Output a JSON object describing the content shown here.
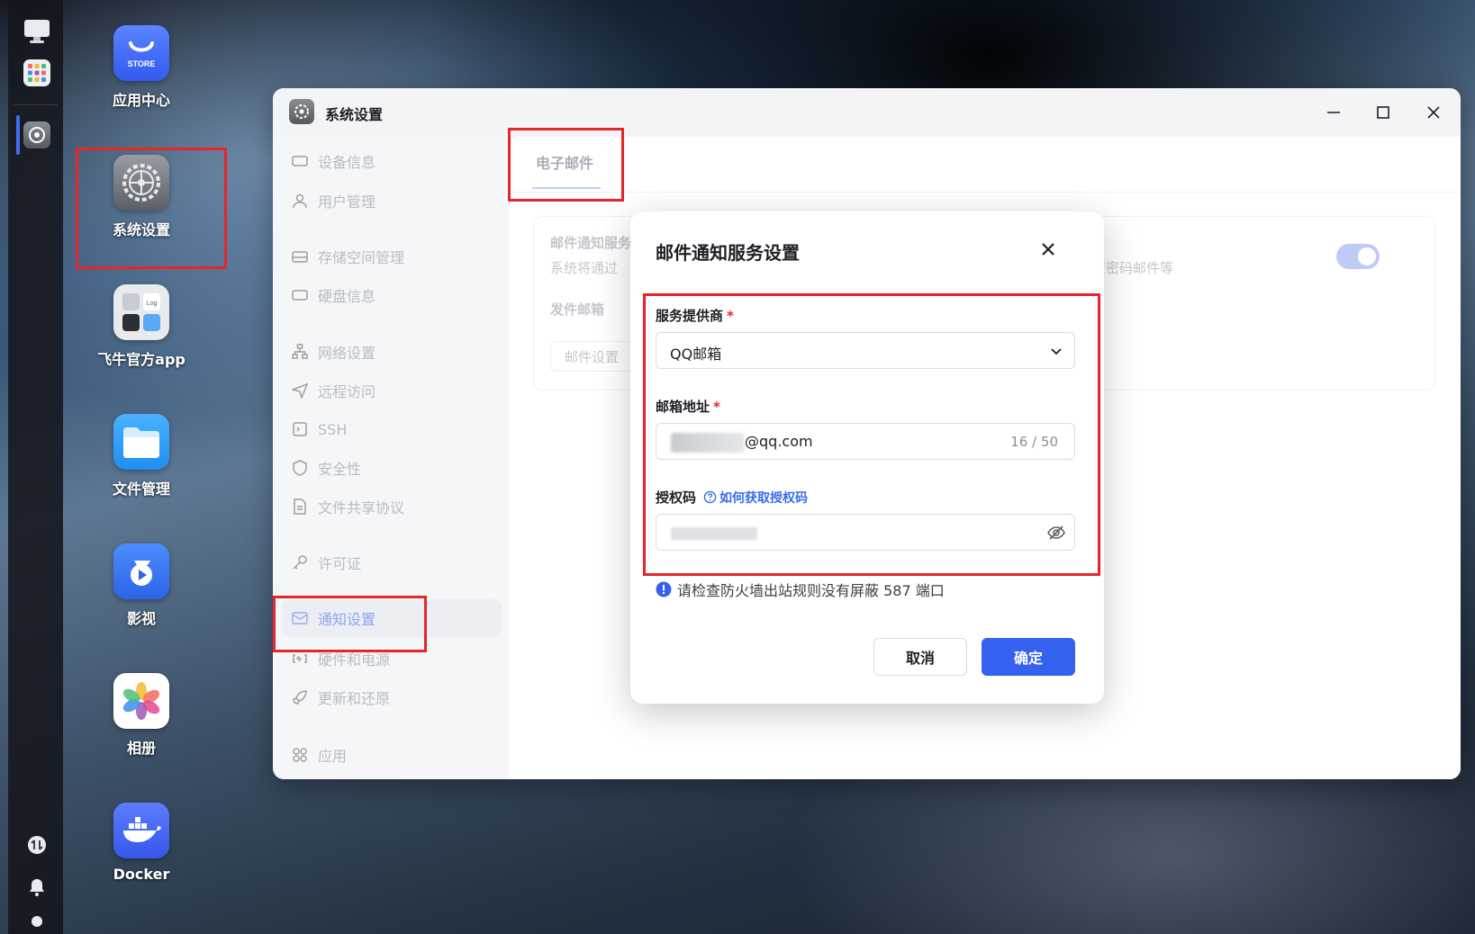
{
  "desktop": {
    "icons": [
      {
        "label": "应用中心",
        "icon": "store-icon",
        "badge": "STORE"
      },
      {
        "label": "系统设置",
        "icon": "gear-icon"
      },
      {
        "label": "飞牛官方app",
        "icon": "app-folder-icon",
        "badge": "Log"
      },
      {
        "label": "文件管理",
        "icon": "folder-icon"
      },
      {
        "label": "影视",
        "icon": "video-icon"
      },
      {
        "label": "相册",
        "icon": "photos-icon"
      },
      {
        "label": "Docker",
        "icon": "docker-icon"
      }
    ]
  },
  "dock": {
    "items": [
      "monitor-icon",
      "apps-grid-icon",
      "settings-icon"
    ],
    "bottom": [
      "transfer-icon",
      "bell-icon",
      "user-icon"
    ]
  },
  "window": {
    "title": "系统设置",
    "controls": [
      "minimize-icon",
      "maximize-icon",
      "close-icon"
    ],
    "sidebar": [
      {
        "label": "设备信息",
        "icon": "device-icon"
      },
      {
        "label": "用户管理",
        "icon": "user-icon"
      },
      {
        "label": "存储空间管理",
        "icon": "storage-icon"
      },
      {
        "label": "硬盘信息",
        "icon": "disk-icon"
      },
      {
        "label": "网络设置",
        "icon": "network-icon"
      },
      {
        "label": "远程访问",
        "icon": "send-icon"
      },
      {
        "label": "SSH",
        "icon": "terminal-icon"
      },
      {
        "label": "安全性",
        "icon": "shield-icon"
      },
      {
        "label": "文件共享协议",
        "icon": "document-icon"
      },
      {
        "label": "许可证",
        "icon": "key-icon"
      },
      {
        "label": "通知设置",
        "icon": "mail-icon",
        "active": true
      },
      {
        "label": "硬件和电源",
        "icon": "power-icon"
      },
      {
        "label": "更新和还原",
        "icon": "rocket-icon"
      },
      {
        "label": "应用",
        "icon": "apps-icon"
      }
    ],
    "tab": "电子邮件",
    "card": {
      "heading": "邮件通知服务",
      "desc_left": "系统将通过",
      "desc_right": "置密码邮件等",
      "sender_label": "发件邮箱",
      "button": "邮件设置"
    }
  },
  "modal": {
    "title": "邮件通知服务设置",
    "provider_label": "服务提供商",
    "provider_value": "QQ邮箱",
    "email_label": "邮箱地址",
    "email_suffix": "@qq.com",
    "email_count": "16 / 50",
    "auth_label": "授权码",
    "auth_help": "如何获取授权码",
    "notice": "请检查防火墙出站规则没有屏蔽 587 端口",
    "cancel": "取消",
    "confirm": "确定",
    "required_mark": "*"
  },
  "colors": {
    "accent": "#3461f0",
    "highlight": "#e5262a"
  }
}
